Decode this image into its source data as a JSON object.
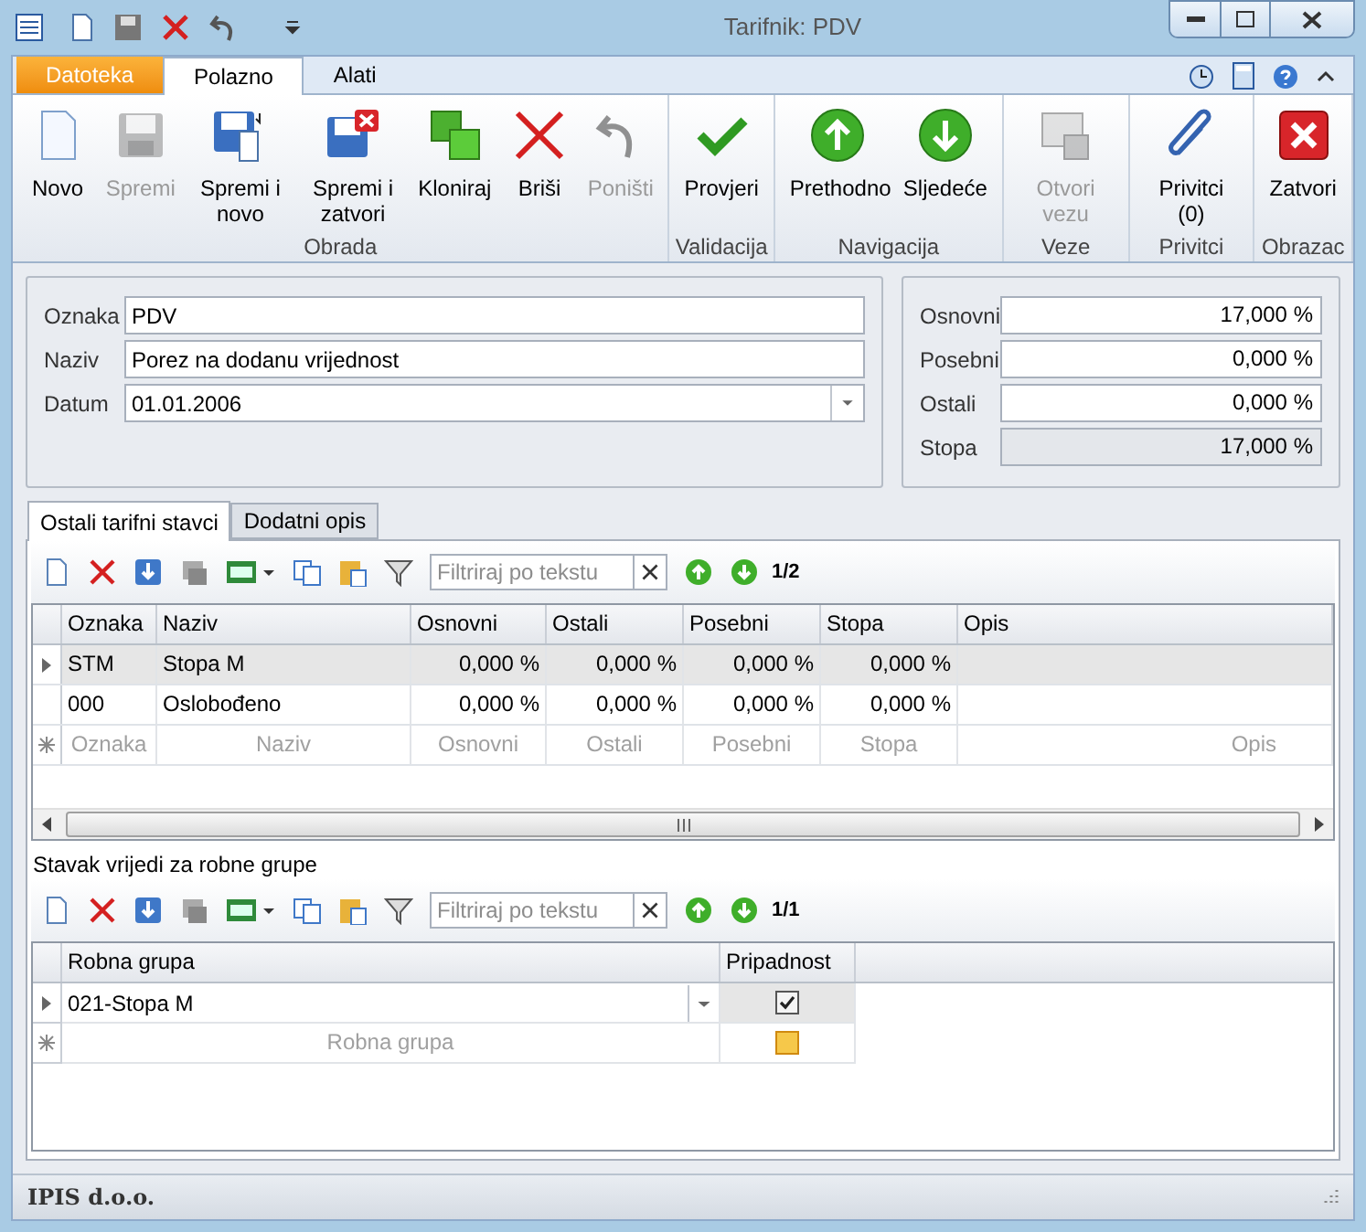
{
  "window": {
    "title": "Tarifnik: PDV"
  },
  "ribbon_tabs": [
    {
      "label": "Datoteka",
      "kind": "file",
      "selected": false
    },
    {
      "label": "Polazno",
      "kind": "tab",
      "selected": true
    },
    {
      "label": "Alati",
      "kind": "tab",
      "selected": false
    }
  ],
  "ribbon_groups": [
    {
      "label": "Obrada",
      "buttons": [
        {
          "label": "Novo",
          "kind": "new",
          "disabled": false
        },
        {
          "label": "Spremi",
          "kind": "save",
          "disabled": true
        },
        {
          "label": "Spremi i novo",
          "kind": "save-new",
          "disabled": false
        },
        {
          "label": "Spremi i zatvori",
          "kind": "save-close",
          "disabled": false
        },
        {
          "label": "Kloniraj",
          "kind": "clone",
          "disabled": false
        },
        {
          "label": "Briši",
          "kind": "delete",
          "disabled": false
        },
        {
          "label": "Poništi",
          "kind": "undo",
          "disabled": true
        }
      ]
    },
    {
      "label": "Validacija",
      "buttons": [
        {
          "label": "Provjeri",
          "kind": "check",
          "disabled": false
        }
      ]
    },
    {
      "label": "Navigacija",
      "buttons": [
        {
          "label": "Prethodno",
          "kind": "up",
          "disabled": false
        },
        {
          "label": "Sljedeće",
          "kind": "down",
          "disabled": false
        }
      ]
    },
    {
      "label": "Veze",
      "buttons": [
        {
          "label": "Otvori vezu",
          "kind": "link",
          "disabled": true
        }
      ]
    },
    {
      "label": "Privitci",
      "buttons": [
        {
          "label": "Privitci (0)",
          "kind": "attach",
          "disabled": false
        }
      ]
    },
    {
      "label": "Obrazac",
      "buttons": [
        {
          "label": "Zatvori",
          "kind": "close",
          "disabled": false
        }
      ]
    }
  ],
  "form": {
    "fields": [
      {
        "label": "Oznaka",
        "value": "PDV",
        "kind": "text"
      },
      {
        "label": "Naziv",
        "value": "Porez na dodanu vrijednost",
        "kind": "text"
      },
      {
        "label": "Datum",
        "value": "01.01.2006",
        "kind": "date"
      }
    ]
  },
  "rates": [
    {
      "label": "Osnovni",
      "value": "17,000 %",
      "readonly": false
    },
    {
      "label": "Posebni",
      "value": "0,000 %",
      "readonly": false
    },
    {
      "label": "Ostali",
      "value": "0,000 %",
      "readonly": false
    },
    {
      "label": "Stopa",
      "value": "17,000 %",
      "readonly": true
    }
  ],
  "detail_tabs": [
    {
      "label": "Ostali tarifni stavci",
      "selected": true
    },
    {
      "label": "Dodatni opis",
      "selected": false
    }
  ],
  "grid1": {
    "filter": {
      "placeholder": "Filtriraj po tekstu"
    },
    "counter": "1/2",
    "columns": [
      "Oznaka",
      "Naziv",
      "Osnovni",
      "Ostali",
      "Posebni",
      "Stopa",
      "Opis"
    ],
    "rows": [
      {
        "cells": [
          "STM",
          "Stopa M",
          "0,000 %",
          "0,000 %",
          "0,000 %",
          "0,000 %",
          ""
        ],
        "selected": true
      },
      {
        "cells": [
          "000",
          "Oslobođeno",
          "0,000 %",
          "0,000 %",
          "0,000 %",
          "0,000 %",
          ""
        ],
        "selected": false
      }
    ],
    "new_row": [
      "Oznaka",
      "Naziv",
      "Osnovni",
      "Ostali",
      "Posebni",
      "Stopa",
      "Opis"
    ]
  },
  "section_title": "Stavak vrijedi za robne grupe",
  "grid2": {
    "filter": {
      "placeholder": "Filtriraj po tekstu"
    },
    "counter": "1/1",
    "columns": [
      "Robna grupa",
      "Pripadnost"
    ],
    "rows": [
      {
        "group": "021-Stopa M",
        "checked": true,
        "selected": true
      }
    ],
    "new_row": [
      "Robna grupa"
    ],
    "new_row_indeterminate": true
  },
  "status_bar": "IPIS d.o.o."
}
